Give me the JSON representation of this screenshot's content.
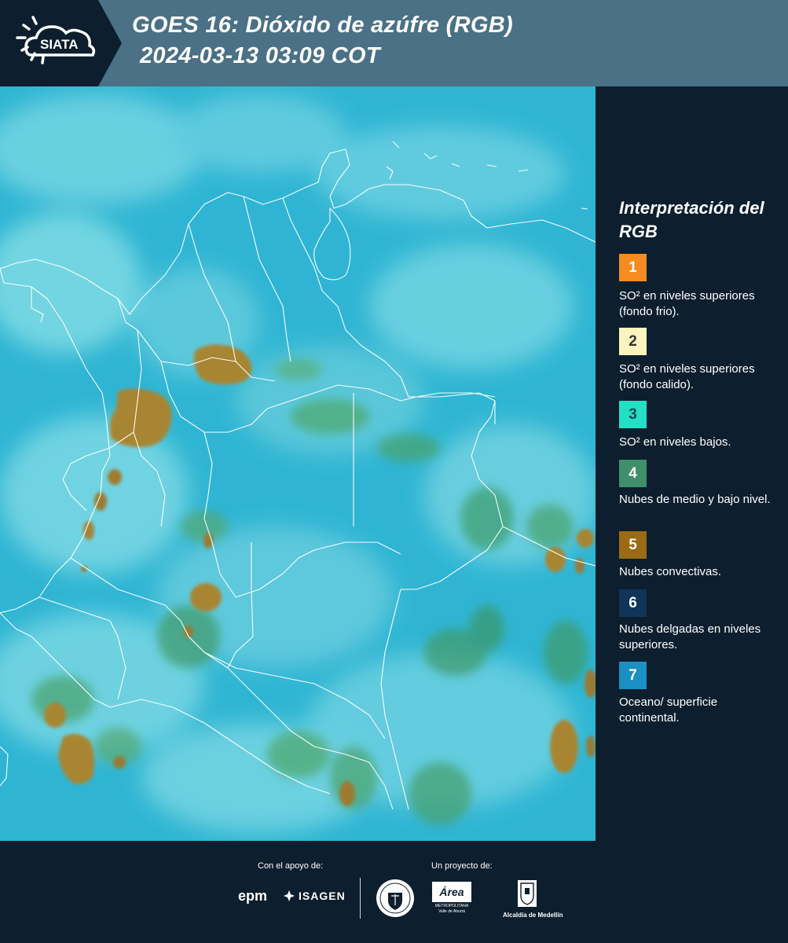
{
  "header": {
    "logo_text": "SIATA",
    "title_line1": "GOES 16: Dióxido de azúfre (RGB)",
    "title_line2": "2024-03-13 03:09 COT"
  },
  "legend": {
    "title": "Interpretación del RGB",
    "items": [
      {
        "number": "1",
        "color": "#f68b1f",
        "text_color": "#ffffff",
        "description": "SO² en niveles superiores (fondo frio)."
      },
      {
        "number": "2",
        "color": "#fdf3bf",
        "text_color": "#333333",
        "description": "SO² en niveles superiores (fondo calido)."
      },
      {
        "number": "3",
        "color": "#22e0c4",
        "text_color": "#1a4a52",
        "description": "SO² en niveles bajos."
      },
      {
        "number": "4",
        "color": "#3e8f6a",
        "text_color": "#ffffff",
        "description": "Nubes de medio y bajo nivel."
      },
      {
        "number": "5",
        "color": "#9b6a14",
        "text_color": "#ffffff",
        "description": "Nubes convectivas."
      },
      {
        "number": "6",
        "color": "#10345a",
        "text_color": "#ffffff",
        "description": "Nubes delgadas en niveles superiores."
      },
      {
        "number": "7",
        "color": "#1a8fc4",
        "text_color": "#ffffff",
        "description": "Oceano/ superficie continental."
      }
    ]
  },
  "footer": {
    "support_label": "Con el apoyo de:",
    "project_label": "Un proyecto de:",
    "epm_logo": "epm",
    "isagen_logo": "ISAGEN",
    "area_logo": "Área",
    "area_subtitle": "METROPOLITANA Valle de Aburrá",
    "alcaldia_logo": "Alcaldía de Medellín"
  },
  "map": {
    "ocean_color": "#2fb5d3",
    "convective_color": "#a88533",
    "vegetation_color": "#4ea86a",
    "border_color": "#ffffff"
  }
}
